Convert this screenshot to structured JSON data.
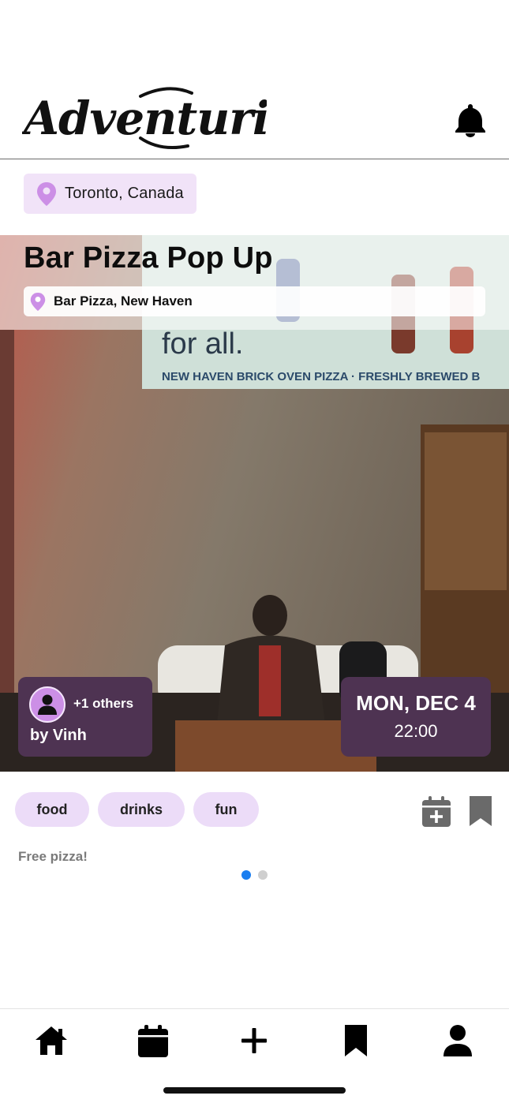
{
  "app": {
    "logo_text": "Adventurista"
  },
  "location": {
    "label": "Toronto, Canada"
  },
  "event": {
    "title": "Bar Pizza Pop Up",
    "venue": "Bar Pizza, New Haven",
    "host_others": "+1 others",
    "host_by": "by Vinh",
    "date": "MON, DEC 4",
    "time": "22:00",
    "tags": [
      "food",
      "drinks",
      "fun"
    ],
    "description": "Free pizza!",
    "photo_sign": {
      "line1": "for all.",
      "line2": "NEW HAVEN BRICK OVEN PIZZA · FRESHLY BREWED B"
    }
  },
  "carousel": {
    "page_count": 2,
    "active_index": 0
  },
  "colors": {
    "accent_purple": "#cc8fe6",
    "chip_bg": "#f1e3f8",
    "card_bg": "#4e3352",
    "tag_bg": "#ecdcf8",
    "dot_active": "#1a7ef0"
  },
  "nav": {
    "items": [
      {
        "icon": "home-icon"
      },
      {
        "icon": "calendar-icon"
      },
      {
        "icon": "plus-icon"
      },
      {
        "icon": "bookmark-icon"
      },
      {
        "icon": "profile-icon"
      }
    ]
  }
}
